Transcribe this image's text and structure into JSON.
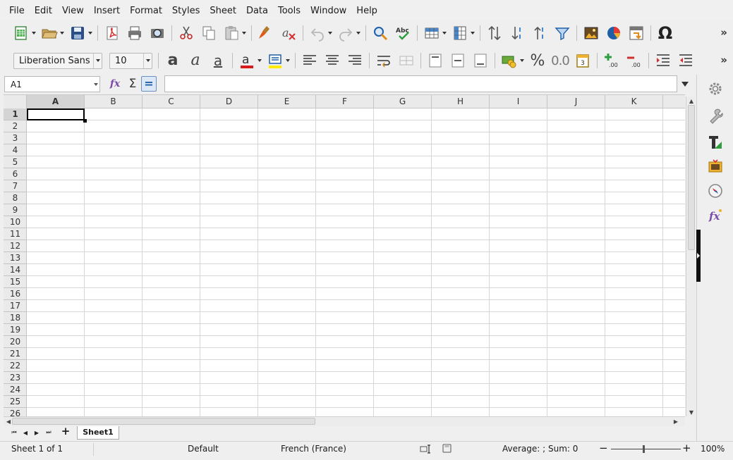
{
  "menu": [
    "File",
    "Edit",
    "View",
    "Insert",
    "Format",
    "Styles",
    "Sheet",
    "Data",
    "Tools",
    "Window",
    "Help"
  ],
  "toolbar": {
    "font_name": "Liberation Sans",
    "font_size": "10",
    "more": "»",
    "spellcheck_label": "Abc",
    "special_char": "Ω",
    "percent": "%",
    "decimal": "0.0",
    "bold_glyph": "a",
    "italic_glyph": "a",
    "underline_glyph": "a",
    "accent_colors": {
      "font_color": "#d81b1b",
      "highlight": "#ffeb00",
      "save": "#1f5fa8"
    }
  },
  "formula_bar": {
    "name_box": "A1",
    "input": "",
    "function_wizard": "fx",
    "sum": "Σ",
    "equals": "="
  },
  "columns": [
    "A",
    "B",
    "C",
    "D",
    "E",
    "F",
    "G",
    "H",
    "I",
    "J",
    "K"
  ],
  "rows": [
    "1",
    "2",
    "3",
    "4",
    "5",
    "6",
    "7",
    "8",
    "9",
    "10",
    "11",
    "12",
    "13",
    "14",
    "15",
    "16",
    "17",
    "18",
    "19",
    "20",
    "21",
    "22",
    "23",
    "24",
    "25",
    "26"
  ],
  "selected_cell": {
    "column": "A",
    "row": "1"
  },
  "sheet_tabs": {
    "add": "+",
    "tabs": [
      "Sheet1"
    ],
    "active": "Sheet1"
  },
  "status": {
    "sheet": "Sheet 1 of 1",
    "page_style": "Default",
    "language": "French (France)",
    "summary": "Average: ; Sum: 0",
    "zoom": "100%",
    "zoom_minus": "−",
    "zoom_plus": "+"
  }
}
